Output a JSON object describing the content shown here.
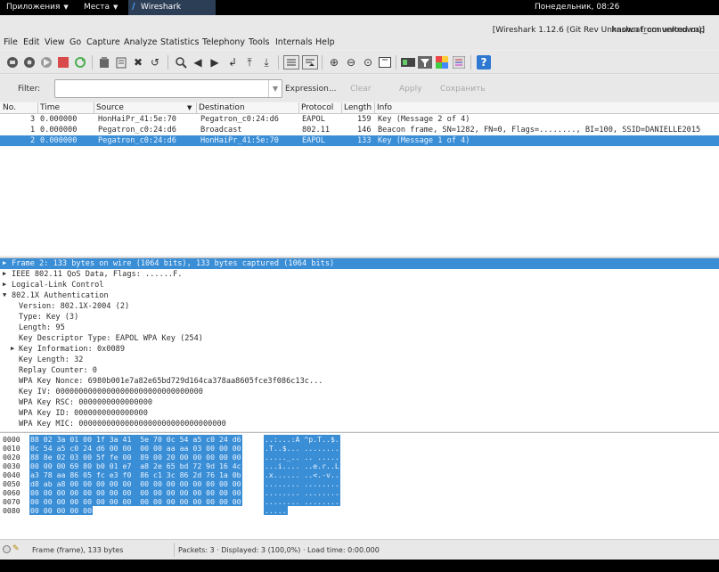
{
  "system_bar": {
    "applications": "Приложения",
    "places": "Места",
    "active_app": "Wireshark",
    "clock": "Понедельник, 08:26"
  },
  "window": {
    "title_file": "hashcat_converted.cap",
    "title_app": "[Wireshark 1.12.6  (Git Rev Unknown from unknown)]"
  },
  "menu": [
    "File",
    "Edit",
    "View",
    "Go",
    "Capture",
    "Analyze",
    "Statistics",
    "Telephony",
    "Tools",
    "Internals",
    "Help"
  ],
  "filter": {
    "label": "Filter:",
    "value": "",
    "expression": "Expression...",
    "clear": "Clear",
    "apply": "Apply",
    "save": "Сохранить"
  },
  "packet_list": {
    "columns": [
      "No.",
      "Time",
      "Source",
      "Destination",
      "Protocol",
      "Length",
      "Info"
    ],
    "rows": [
      {
        "no": "3",
        "time": "0.000000",
        "source": "HonHaiPr_41:5e:70",
        "destination": "Pegatron_c0:24:d6",
        "protocol": "EAPOL",
        "length": "159",
        "info": "Key (Message 2 of 4)"
      },
      {
        "no": "1",
        "time": "0.000000",
        "source": "Pegatron_c0:24:d6",
        "destination": "Broadcast",
        "protocol": "802.11",
        "length": "146",
        "info": "Beacon frame, SN=1282, FN=0, Flags=........, BI=100, SSID=DANIELLE2015"
      },
      {
        "no": "2",
        "time": "0.000000",
        "source": "Pegatron_c0:24:d6",
        "destination": "HonHaiPr_41:5e:70",
        "protocol": "EAPOL",
        "length": "133",
        "info": "Key (Message 1 of 4)"
      }
    ]
  },
  "details": {
    "frame": "Frame 2: 133 bytes on wire (1064 bits), 133 bytes captured (1064 bits)",
    "qos": "IEEE 802.11 QoS Data, Flags: ......F.",
    "llc": "Logical-Link Control",
    "auth": "802.1X Authentication",
    "version": "Version: 802.1X-2004 (2)",
    "type": "Type: Key (3)",
    "length": "Length: 95",
    "key_descriptor": "Key Descriptor Type: EAPOL WPA Key (254)",
    "key_information": "Key Information: 0x0089",
    "key_length": "Key Length: 32",
    "replay_counter": "Replay Counter: 0",
    "wpa_nonce": "WPA Key Nonce: 6980b001e7a82e65bd729d164ca378aa8605fce3f086c13c...",
    "key_iv": "Key IV: 00000000000000000000000000000000",
    "key_rsc": "WPA Key RSC: 0000000000000000",
    "key_id": "WPA Key ID: 0000000000000000",
    "key_mic": "WPA Key MIC: 00000000000000000000000000000000"
  },
  "bytes": [
    {
      "offset": "0000",
      "hex": "88 02 3a 01 00 1f 3a 41  5e 70 0c 54 a5 c0 24 d6",
      "ascii": "..:...:A ^p.T..$."
    },
    {
      "offset": "0010",
      "hex": "0c 54 a5 c0 24 d6 00 00  00 00 aa aa 03 00 00 00",
      "ascii": ".T..$... ........"
    },
    {
      "offset": "0020",
      "hex": "88 8e 02 03 00 5f fe 00  89 00 20 00 00 00 00 00",
      "ascii": "....._.. .. ....."
    },
    {
      "offset": "0030",
      "hex": "00 00 00 69 80 b0 01 e7  a8 2e 65 bd 72 9d 16 4c",
      "ascii": "...i.... ..e.r..L"
    },
    {
      "offset": "0040",
      "hex": "a3 78 aa 86 05 fc e3 f0  86 c1 3c 86 2d 76 1a 0b",
      "ascii": ".x...... ..<.-v.."
    },
    {
      "offset": "0050",
      "hex": "d8 ab a8 00 00 00 00 00  00 00 00 00 00 00 00 00",
      "ascii": "........ ........"
    },
    {
      "offset": "0060",
      "hex": "00 00 00 00 00 00 00 00  00 00 00 00 00 00 00 00",
      "ascii": "........ ........"
    },
    {
      "offset": "0070",
      "hex": "00 00 00 00 00 00 00 00  00 00 00 00 00 00 00 00",
      "ascii": "........ ........"
    },
    {
      "offset": "0080",
      "hex": "00 00 00 00 00",
      "ascii": "....."
    }
  ],
  "status": {
    "frame_info": "Frame (frame), 133 bytes",
    "packets": "Packets: 3 · Displayed: 3 (100,0%) · Load time: 0:00.000"
  },
  "colors": {
    "selection": "#3a8ed6",
    "help_icon": "#2f78d2",
    "stop_icon": "#d94a4a"
  }
}
